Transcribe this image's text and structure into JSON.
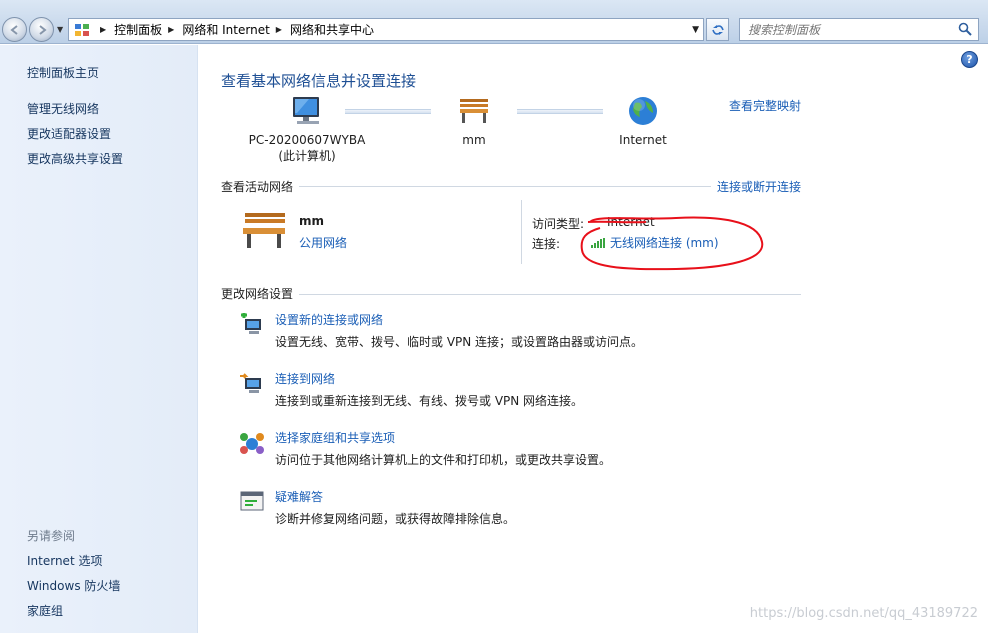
{
  "address_bar": {
    "crumbs": [
      "控制面板",
      "网络和 Internet",
      "网络和共享中心"
    ],
    "search_placeholder": "搜索控制面板"
  },
  "left_pane": {
    "links": [
      "控制面板主页",
      "管理无线网络",
      "更改适配器设置",
      "更改高级共享设置"
    ],
    "see_also_heading": "另请参阅",
    "see_also": [
      "Internet 选项",
      "Windows 防火墙",
      "家庭组"
    ]
  },
  "main": {
    "title": "查看基本网络信息并设置连接",
    "view_full_map": "查看完整映射",
    "map": {
      "computer_name": "PC-20200607WYBA",
      "computer_caption": "(此计算机)",
      "network_name": "mm",
      "internet_label": "Internet"
    },
    "active_networks": {
      "heading": "查看活动网络",
      "connect_disconnect": "连接或断开连接",
      "name": "mm",
      "type": "公用网络",
      "access_type_label": "访问类型:",
      "access_type_value": "Internet",
      "connections_label": "连接:",
      "connection_name": "无线网络连接 (mm)"
    },
    "change_settings": {
      "heading": "更改网络设置",
      "tasks": [
        {
          "link": "设置新的连接或网络",
          "desc": "设置无线、宽带、拨号、临时或 VPN 连接；或设置路由器或访问点。"
        },
        {
          "link": "连接到网络",
          "desc": "连接到或重新连接到无线、有线、拨号或 VPN 网络连接。"
        },
        {
          "link": "选择家庭组和共享选项",
          "desc": "访问位于其他网络计算机上的文件和打印机，或更改共享设置。"
        },
        {
          "link": "疑难解答",
          "desc": "诊断并修复网络问题，或获得故障排除信息。"
        }
      ]
    }
  },
  "watermark": "https://blog.csdn.net/qq_43189722",
  "colors": {
    "link": "#1a5eb6",
    "title": "#1e4f94",
    "annotation": "#e8101a"
  }
}
